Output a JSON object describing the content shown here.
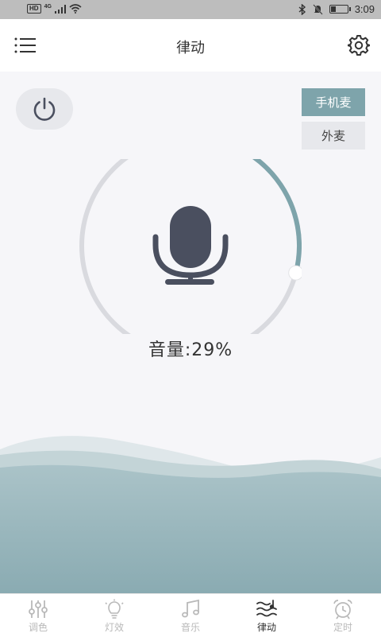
{
  "status_bar": {
    "network_badge": "HD",
    "network_type": "4G",
    "time": "3:09",
    "battery_level": 0.3
  },
  "header": {
    "title": "律动",
    "menu_icon": "list-icon",
    "settings_icon": "gear-icon"
  },
  "controls": {
    "power_icon": "power-icon",
    "mic_phone_label": "手机麦",
    "mic_external_label": "外麦",
    "selected_mic": "手机麦"
  },
  "volume": {
    "label": "音量:29%",
    "value_percent": 29,
    "mic_icon": "microphone-icon"
  },
  "colors": {
    "accent": "#7ea4ab",
    "ring_track": "#d9dadf",
    "mic": "#4a4f5f",
    "wave": "#8fb0b7"
  },
  "tabs": [
    {
      "label": "调色",
      "icon": "sliders-icon",
      "active": false
    },
    {
      "label": "灯效",
      "icon": "bulb-icon",
      "active": false
    },
    {
      "label": "音乐",
      "icon": "music-note-icon",
      "active": false
    },
    {
      "label": "律动",
      "icon": "rhythm-wave-icon",
      "active": true
    },
    {
      "label": "定时",
      "icon": "alarm-clock-icon",
      "active": false
    }
  ]
}
